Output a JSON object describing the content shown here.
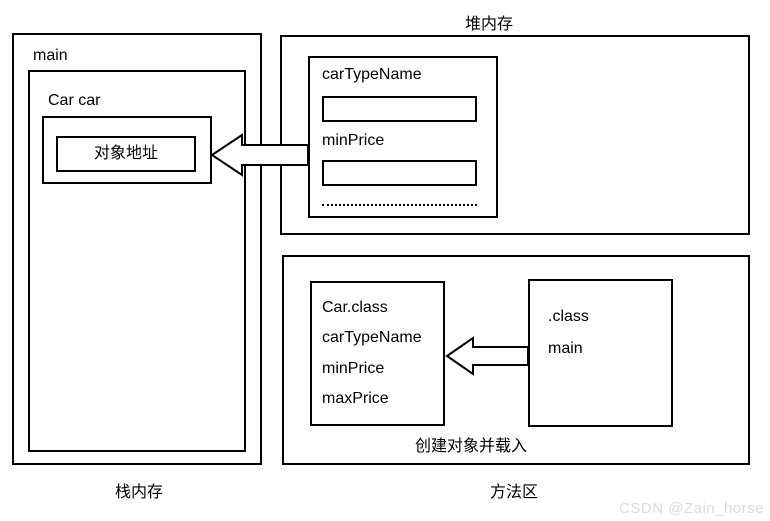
{
  "heap": {
    "title": "堆内存",
    "field1": "carTypeName",
    "field2": "minPrice"
  },
  "stack": {
    "title": "栈内存",
    "frame": "main",
    "var": "Car car",
    "value": "对象地址"
  },
  "method_area": {
    "title": "方法区",
    "caption": "创建对象并载入",
    "classbox": {
      "l1": "Car.class",
      "l2": "carTypeName",
      "l3": "minPrice",
      "l4": "maxPrice"
    },
    "runtime": {
      "l1": ".class",
      "l2": "main"
    }
  },
  "watermark": "CSDN @Zain_horse"
}
